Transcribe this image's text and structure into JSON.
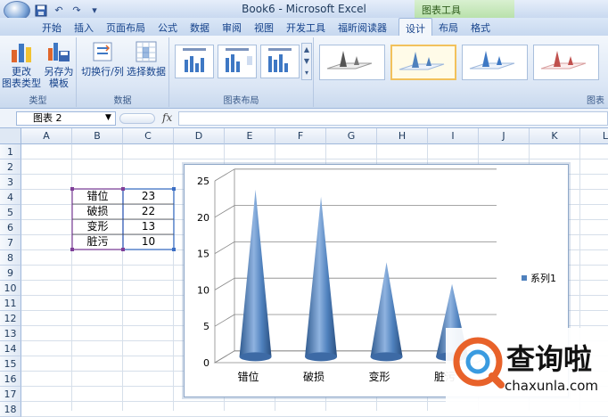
{
  "window": {
    "title": "Book6 - Microsoft Excel",
    "context_tab_group": "图表工具"
  },
  "tabs": [
    "开始",
    "插入",
    "页面布局",
    "公式",
    "数据",
    "审阅",
    "视图",
    "开发工具",
    "福昕阅读器",
    "设计",
    "布局",
    "格式"
  ],
  "active_tab": "设计",
  "ribbon": {
    "groups": {
      "type": "类型",
      "data": "数据",
      "layout": "图表布局",
      "styles": "图表"
    },
    "buttons": {
      "change_type_1": "更改",
      "change_type_2": "图表类型",
      "save_template_1": "另存为",
      "save_template_2": "模板",
      "switch_rowcol": "切换行/列",
      "select_data": "选择数据"
    }
  },
  "formula_bar": {
    "name_box": "图表 2",
    "fx": "fx"
  },
  "columns": [
    "A",
    "B",
    "C",
    "D",
    "E",
    "F",
    "G",
    "H",
    "I",
    "J",
    "K",
    "L"
  ],
  "rows": [
    "1",
    "2",
    "3",
    "4",
    "5",
    "6",
    "7",
    "8",
    "9",
    "10",
    "11",
    "12",
    "13",
    "14",
    "15",
    "16",
    "17",
    "18"
  ],
  "table": [
    {
      "label": "错位",
      "value": "23"
    },
    {
      "label": "破损",
      "value": "22"
    },
    {
      "label": "变形",
      "value": "13"
    },
    {
      "label": "脏污",
      "value": "10"
    }
  ],
  "chart_data": {
    "type": "bar",
    "categories": [
      "错位",
      "破损",
      "变形",
      "脏污"
    ],
    "series": [
      {
        "name": "系列1",
        "values": [
          23,
          22,
          13,
          10
        ]
      }
    ],
    "ylim": [
      0,
      25
    ],
    "yticks": [
      "0",
      "5",
      "10",
      "15",
      "20",
      "25"
    ],
    "legend_position": "right",
    "grid": true,
    "shape": "cone",
    "color": "#4f81bd"
  },
  "watermark": {
    "brand": "查询啦",
    "url": "chaxunla.com"
  }
}
